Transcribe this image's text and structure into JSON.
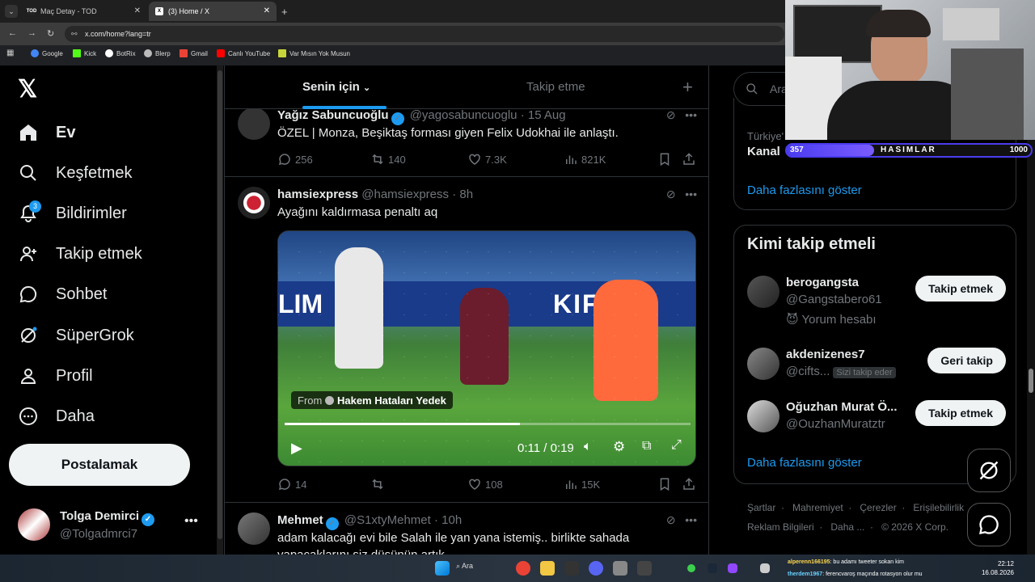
{
  "browser": {
    "tabs": [
      {
        "title": "Maç Detay - TOD",
        "favicon": "TOD"
      },
      {
        "title": "(3) Home / X",
        "favicon": "X"
      }
    ],
    "url": "x.com/home?lang=tr",
    "bookmarks": [
      "Google",
      "Kick",
      "BotRix",
      "Blerp",
      "Gmail",
      "Canlı YouTube",
      "Var Mısın Yok Musun"
    ]
  },
  "sidebar": {
    "items": [
      {
        "label": "Ev",
        "icon": "home-icon"
      },
      {
        "label": "Keşfetmek",
        "icon": "search-icon"
      },
      {
        "label": "Bildirimler",
        "icon": "bell-icon",
        "badge": "3"
      },
      {
        "label": "Takip etmek",
        "icon": "follow-icon"
      },
      {
        "label": "Sohbet",
        "icon": "chat-icon"
      },
      {
        "label": "SüperGrok",
        "icon": "grok-icon"
      },
      {
        "label": "Profil",
        "icon": "profile-icon"
      },
      {
        "label": "Daha",
        "icon": "more-icon"
      }
    ],
    "post_label": "Postalamak",
    "account": {
      "name": "Tolga Demirci",
      "handle": "@Tolgadmrci7"
    }
  },
  "timeline": {
    "tabs": [
      "Senin için",
      "Takip etme"
    ],
    "tweets": [
      {
        "name": "Yağız Sabuncuoğlu",
        "handle": "@yagosabuncuoglu",
        "time": "· 15 Aug",
        "text": "ÖZEL | Monza, Beşiktaş forması giyen Felix Udokhai ile anlaştı.",
        "replies": "256",
        "reposts": "140",
        "likes": "7.3K",
        "views": "821K"
      },
      {
        "name": "hamsiexpress",
        "handle": "@hamsiexpress",
        "time": "· 8h",
        "text": "Ayağını kaldırmasa penaltı aq",
        "video": {
          "from_label": "From",
          "from_name": "Hakem Hataları Yedek",
          "time": "0:11 / 0:19",
          "progress": 0.58
        },
        "replies": "14",
        "reposts": "",
        "likes": "108",
        "views": "15K"
      },
      {
        "name": "Mehmet",
        "handle": "@S1xtyMehmet",
        "time": "· 10h",
        "text": "adam kalacağı evi bile Salah ile yan yana istemiş.. birlikte sahada",
        "text2": "yapacaklarını siz düşünün artık"
      }
    ]
  },
  "right": {
    "search_placeholder": "Ara",
    "trend_prefix": "Türkiye'",
    "trend_title": "Kanal",
    "show_more": "Daha fazlasını göster",
    "who_to_follow": "Kimi takip etmeli",
    "suggestions": [
      {
        "name": "berogangsta",
        "handle": "@Gangstabero61",
        "extra": "Yorum hesabı",
        "button": "Takip etmek"
      },
      {
        "name": "akdenizenes7",
        "handle": "@cifts...",
        "follows_you": "Sizi takip eder",
        "button": "Geri takip"
      },
      {
        "name": "Oğuzhan Murat Ö...",
        "handle": "@OuzhanMuratztr",
        "button": "Takip etmek"
      }
    ],
    "footer1": [
      "Şartlar",
      "Mahremiyet",
      "Çerezler",
      "Erişilebilirlik"
    ],
    "footer2": [
      "Reklam Bilgileri",
      "Daha ...",
      "© 2026 X Corp."
    ]
  },
  "stream_overlay": {
    "left_value": "357",
    "label": "HASIMLAR",
    "right_value": "1000",
    "progress": 0.357
  },
  "taskbar": {
    "search": "Ara",
    "time": "22:12",
    "date": "16.08.2026",
    "chat1_user": "alperenn166195",
    "chat1_msg": ": bu adamı tweeter sokan kim",
    "chat2_user": "therdem1967",
    "chat2_msg": ": ferencvaroş maçında rotasyon olur mu"
  },
  "colors": {
    "accent": "#1d9bf0",
    "bg": "#000000",
    "text": "#e7e9ea",
    "muted": "#71767b",
    "border": "#2f3336"
  }
}
